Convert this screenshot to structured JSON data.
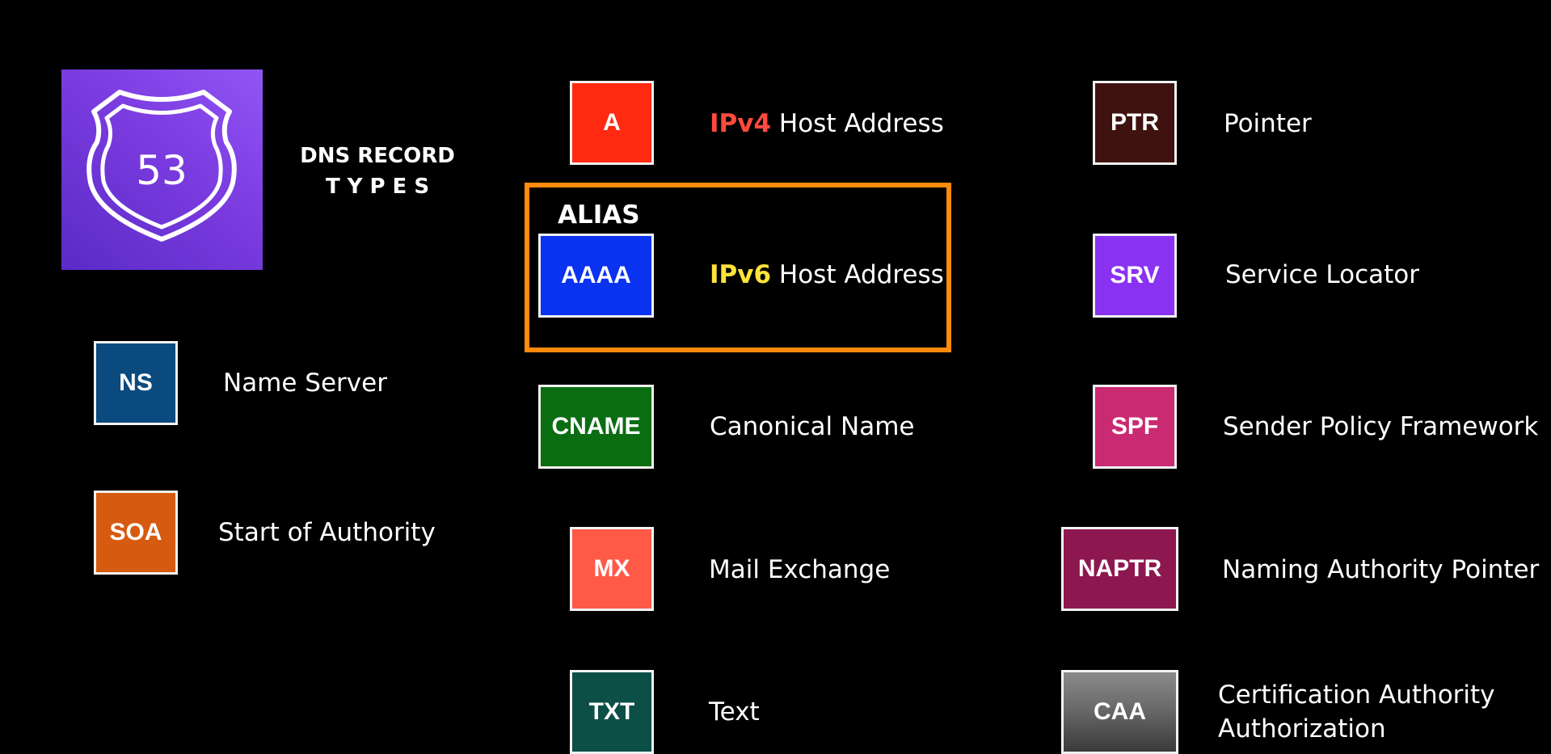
{
  "header": {
    "logo_text": "53",
    "title_main": "DNS RECORD",
    "title_sub": "TYPES"
  },
  "alias_label": "ALIAS",
  "colors": {
    "background": "#000000",
    "alias_border": "#ff8a0c",
    "ipv4_highlight": "#ff4a3d",
    "ipv6_highlight": "#ffe23a"
  },
  "records": {
    "ns": {
      "type": "NS",
      "label": "Name Server",
      "color": "#0b4a7e"
    },
    "soa": {
      "type": "SOA",
      "label": "Start of Authority",
      "color": "#d65a10"
    },
    "a": {
      "type": "A",
      "highlight": "IPv4",
      "label": " Host Address",
      "color": "#ff2a10"
    },
    "aaaa": {
      "type": "AAAA",
      "highlight": "IPv6",
      "label": " Host Address",
      "color": "#0a33f0"
    },
    "cname": {
      "type": "CNAME",
      "label": "Canonical Name",
      "color": "#0b6d12"
    },
    "mx": {
      "type": "MX",
      "label": "Mail Exchange",
      "color": "#ff5a48"
    },
    "txt": {
      "type": "TXT",
      "label": "Text",
      "color": "#0c4f47"
    },
    "ptr": {
      "type": "PTR",
      "label": "Pointer",
      "color": "#3f1210"
    },
    "srv": {
      "type": "SRV",
      "label": "Service Locator",
      "color": "#8a32f2"
    },
    "spf": {
      "type": "SPF",
      "label": "Sender Policy Framework",
      "color": "#c92a72"
    },
    "naptr": {
      "type": "NAPTR",
      "label": "Naming Authority Pointer",
      "color": "#8d1850"
    },
    "caa": {
      "type": "CAA",
      "label_line1": "Certification Authority",
      "label_line2": "Authorization",
      "color": "#6a6a6a"
    }
  }
}
